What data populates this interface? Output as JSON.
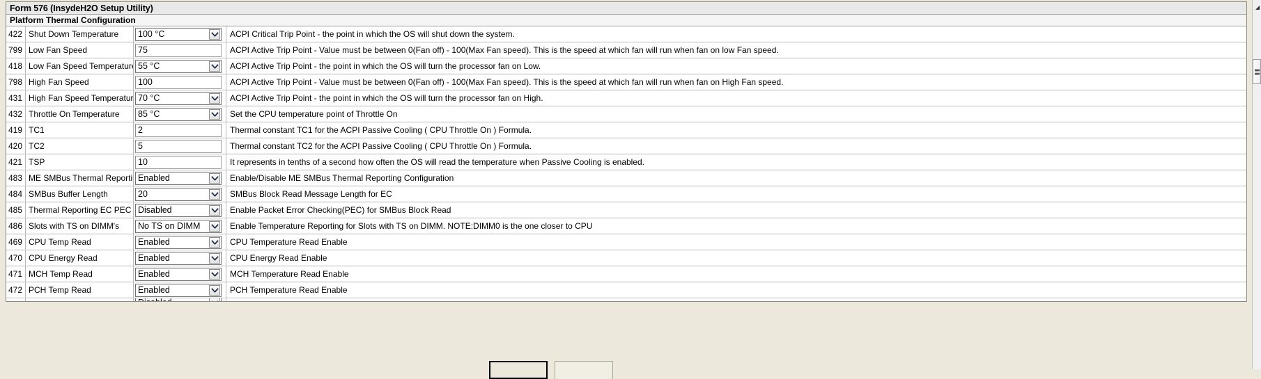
{
  "window": {
    "form_title": "Form 576 (InsydeH2O Setup Utility)",
    "section_title": "Platform Thermal Configuration"
  },
  "icons": {
    "chevron_down": "chevron-down-icon",
    "scroll_up_arrow": "scroll-up-arrow-icon",
    "scrollbar_grip": "scrollbar-grip-icon"
  },
  "rows": [
    {
      "id": "422",
      "label": "Shut Down Temperature",
      "control": "select",
      "value": "100 °C",
      "description": "ACPI Critical Trip Point - the point in which the OS will shut down the system."
    },
    {
      "id": "799",
      "label": "Low Fan Speed",
      "control": "text",
      "value": "75",
      "description": "ACPI Active Trip Point - Value must be between 0(Fan off) - 100(Max Fan speed). This is the speed at which fan will run when fan on low Fan speed."
    },
    {
      "id": "418",
      "label": "Low Fan Speed Temperature",
      "control": "select",
      "value": "55 °C",
      "description": "ACPI Active Trip Point - the point in which the OS will turn the processor fan on Low."
    },
    {
      "id": "798",
      "label": "High Fan Speed",
      "control": "text",
      "value": "100",
      "description": "ACPI Active Trip Point - Value must be between 0(Fan off) - 100(Max Fan speed). This is the speed at which fan will run when fan on High Fan speed."
    },
    {
      "id": "431",
      "label": "High Fan Speed Temperature",
      "control": "select",
      "value": "70 °C",
      "description": "ACPI Active Trip Point - the point in which the OS will turn the processor fan on High."
    },
    {
      "id": "432",
      "label": "Throttle On Temperature",
      "control": "select",
      "value": "85 °C",
      "description": "Set the CPU temperature point of Throttle On"
    },
    {
      "id": "419",
      "label": "TC1",
      "control": "text",
      "value": "2",
      "description": "Thermal constant TC1 for the ACPI Passive Cooling ( CPU Throttle On ) Formula."
    },
    {
      "id": "420",
      "label": "TC2",
      "control": "text",
      "value": "5",
      "description": "Thermal constant TC2 for the ACPI Passive Cooling ( CPU Throttle On ) Formula."
    },
    {
      "id": "421",
      "label": "TSP",
      "control": "text",
      "value": "10",
      "description": "It represents in tenths of a second how often the OS will read the temperature when Passive Cooling is enabled."
    },
    {
      "id": "483",
      "label": "ME SMBus Thermal Reporting",
      "control": "select",
      "value": "Enabled",
      "description": "Enable/Disable ME SMBus Thermal Reporting Configuration"
    },
    {
      "id": "484",
      "label": "SMBus Buffer Length",
      "control": "select",
      "value": "20",
      "description": "SMBus Block Read Message Length for EC"
    },
    {
      "id": "485",
      "label": "Thermal Reporting EC PEC",
      "control": "select",
      "value": "Disabled",
      "description": "Enable Packet Error Checking(PEC) for SMBus Block Read"
    },
    {
      "id": "486",
      "label": "Slots with TS on DIMM's",
      "control": "select",
      "value": "No TS on DIMM",
      "description": "Enable Temperature Reporting for Slots with TS on DIMM. NOTE:DIMM0 is the one closer to CPU"
    },
    {
      "id": "469",
      "label": "CPU Temp Read",
      "control": "select",
      "value": "Enabled",
      "description": "CPU Temperature Read Enable"
    },
    {
      "id": "470",
      "label": "CPU Energy Read",
      "control": "select",
      "value": "Enabled",
      "description": "CPU Energy Read Enable"
    },
    {
      "id": "471",
      "label": "MCH Temp Read",
      "control": "select",
      "value": "Enabled",
      "description": "MCH Temperature Read Enable"
    },
    {
      "id": "472",
      "label": "PCH Temp Read",
      "control": "select",
      "value": "Enabled",
      "description": "PCH Temperature Read Enable"
    }
  ],
  "partial_row": {
    "id": "",
    "label": "",
    "control": "select",
    "value": "Disabled",
    "description": ""
  },
  "buttons": {
    "primary_label": "",
    "secondary_label": ""
  },
  "colors": {
    "desktop": "#ece9dc",
    "form_background": "#ffffff",
    "title_background": "#e8e8e8",
    "grid_line": "#b9b9b9"
  }
}
